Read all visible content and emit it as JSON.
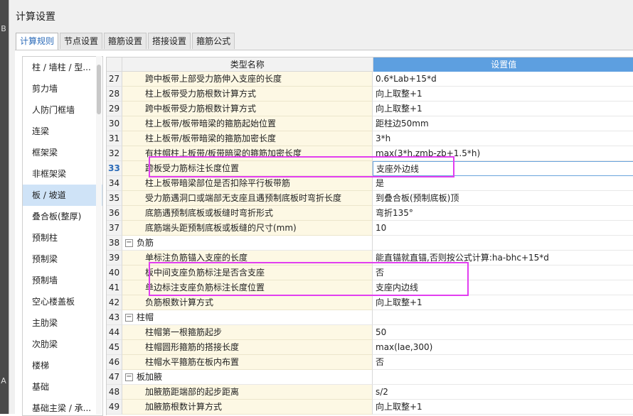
{
  "window": {
    "title": "计算设置"
  },
  "tabs": [
    "计算规则",
    "节点设置",
    "箍筋设置",
    "搭接设置",
    "箍筋公式"
  ],
  "sidebar": {
    "items": [
      "柱 / 墙柱 / 型...",
      "剪力墙",
      "人防门框墙",
      "连梁",
      "框架梁",
      "非框架梁",
      "板 / 坡道",
      "叠合板(整厚)",
      "预制柱",
      "预制梁",
      "预制墙",
      "空心楼盖板",
      "主肋梁",
      "次肋梁",
      "楼梯",
      "基础",
      "基础主梁 / 承..."
    ],
    "active_index": 6
  },
  "grid": {
    "header": {
      "name": "类型名称",
      "value": "设置值"
    },
    "current_row": "33",
    "rows": [
      {
        "num": "27",
        "name": "跨中板带上部受力筋伸入支座的长度",
        "value": "0.6*Lab+15*d"
      },
      {
        "num": "28",
        "name": "柱上板带受力筋根数计算方式",
        "value": "向上取整+1"
      },
      {
        "num": "29",
        "name": "跨中板带受力筋根数计算方式",
        "value": "向上取整+1"
      },
      {
        "num": "30",
        "name": "柱上板带/板带暗梁的箍筋起始位置",
        "value": "距柱边50mm"
      },
      {
        "num": "31",
        "name": "柱上板带/板带暗梁的箍筋加密长度",
        "value": "3*h"
      },
      {
        "num": "32",
        "name": "有柱帽柱上板带/板带暗梁的箍筋加密长度",
        "value": "max(3*h,zmb-zb+1.5*h)"
      },
      {
        "num": "33",
        "name": "跨板受力筋标注长度位置",
        "value": "支座外边线"
      },
      {
        "num": "34",
        "name": "柱上板带暗梁部位是否扣除平行板带筋",
        "value": "是"
      },
      {
        "num": "35",
        "name": "受力筋遇洞口或端部无支座且遇预制底板时弯折长度",
        "value": "到叠合板(预制底板)顶"
      },
      {
        "num": "36",
        "name": "底筋遇预制底板或板缝时弯折形式",
        "value": "弯折135°"
      },
      {
        "num": "37",
        "name": "底筋端头距预制底板或板缝的尺寸(mm)",
        "value": "10"
      },
      {
        "num": "38",
        "name": "负筋",
        "value": "",
        "group": true
      },
      {
        "num": "39",
        "name": "单标注负筋锚入支座的长度",
        "value": "能直锚就直锚,否则按公式计算:ha-bhc+15*d"
      },
      {
        "num": "40",
        "name": "板中间支座负筋标注是否含支座",
        "value": "否"
      },
      {
        "num": "41",
        "name": "单边标注支座负筋标注长度位置",
        "value": "支座内边线"
      },
      {
        "num": "42",
        "name": "负筋根数计算方式",
        "value": "向上取整+1"
      },
      {
        "num": "43",
        "name": "柱帽",
        "value": "",
        "group": true
      },
      {
        "num": "44",
        "name": "柱帽第一根箍筋起步",
        "value": "50"
      },
      {
        "num": "45",
        "name": "柱帽圆形箍筋的搭接长度",
        "value": "max(lae,300)"
      },
      {
        "num": "46",
        "name": "柱帽水平箍筋在板内布置",
        "value": "否"
      },
      {
        "num": "47",
        "name": "板加腋",
        "value": "",
        "group": true
      },
      {
        "num": "48",
        "name": "加腋筋距端部的起步距离",
        "value": "s/2"
      },
      {
        "num": "49",
        "name": "加腋筋根数计算方式",
        "value": "向上取整+1"
      }
    ]
  },
  "left_edge_marks": [
    "B",
    "A"
  ],
  "colors": {
    "accent": "#5d9fe0",
    "highlight": "#e23ef0",
    "name_cell_bg": "#fdf8e4",
    "sidebar_active": "#cfe3f7"
  }
}
